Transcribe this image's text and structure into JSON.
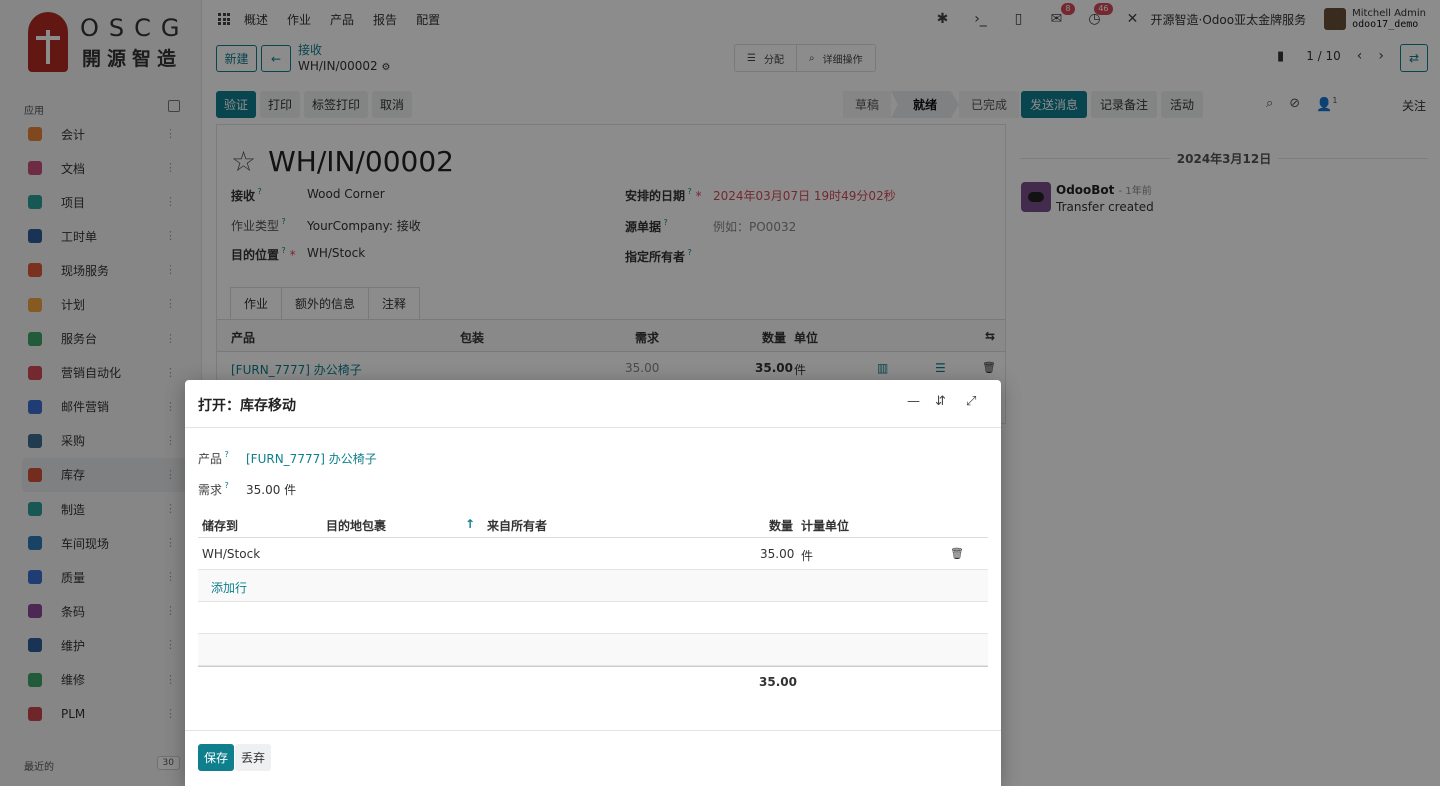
{
  "brand": {
    "line1": "OSCG",
    "line2": "開源智造"
  },
  "sidebar": {
    "section_label": "应用",
    "items": [
      {
        "label": "会计",
        "color": "#e8833a"
      },
      {
        "label": "文档",
        "color": "#c94f7c"
      },
      {
        "label": "项目",
        "color": "#2aa19a"
      },
      {
        "label": "工时单",
        "color": "#2f5d9c"
      },
      {
        "label": "现场服务",
        "color": "#e05a3a"
      },
      {
        "label": "计划",
        "color": "#f2a541"
      },
      {
        "label": "服务台",
        "color": "#3fa66b"
      },
      {
        "label": "营销自动化",
        "color": "#d44c59"
      },
      {
        "label": "邮件营销",
        "color": "#3a6fd1"
      },
      {
        "label": "采购",
        "color": "#3b6e8f"
      },
      {
        "label": "库存",
        "color": "#d4513a"
      },
      {
        "label": "制造",
        "color": "#2aa19a"
      },
      {
        "label": "车间现场",
        "color": "#2f7ab8"
      },
      {
        "label": "质量",
        "color": "#3a6fd1"
      },
      {
        "label": "条码",
        "color": "#8f4a9c"
      },
      {
        "label": "维护",
        "color": "#2f5d9c"
      },
      {
        "label": "维修",
        "color": "#3fa66b"
      },
      {
        "label": "PLM",
        "color": "#c9454f"
      }
    ],
    "active_index": 10,
    "footer_label": "最近的",
    "footer_count": "30"
  },
  "topbar": {
    "menu": [
      "概述",
      "作业",
      "产品",
      "报告",
      "配置"
    ],
    "messages_badge": "8",
    "activities_badge": "46",
    "company": "开源智造·Odoo亚太金牌服务",
    "user_name": "Mitchell Admin",
    "db_name": "odoo17_demo"
  },
  "control": {
    "new_label": "新建",
    "breadcrumb_parent": "接收",
    "breadcrumb_current": "WH/IN/00002",
    "assign_label": "分配",
    "details_label": "详细操作",
    "pager": "1 / 10"
  },
  "actions": {
    "validate": "验证",
    "print": "打印",
    "label_print": "标签打印",
    "cancel": "取消"
  },
  "status": {
    "draft": "草稿",
    "ready": "就绪",
    "done": "已完成"
  },
  "record": {
    "title": "WH/IN/00002",
    "receive_from_label": "接收",
    "receive_from": "Wood Corner",
    "op_type_label": "作业类型",
    "op_type": "YourCompany: 接收",
    "dest_label": "目的位置",
    "dest": "WH/Stock",
    "scheduled_label": "安排的日期",
    "scheduled": "2024年03月07日 19时49分02秒",
    "source_label": "源单据",
    "source_placeholder": "例如：PO0032",
    "owner_label": "指定所有者",
    "tabs": [
      "作业",
      "额外的信息",
      "注释"
    ],
    "columns": {
      "product": "产品",
      "package": "包装",
      "demand": "需求",
      "qty": "数量",
      "uom": "单位"
    },
    "line": {
      "product": "[FURN_7777] 办公椅子",
      "demand": "35.00",
      "qty": "35.00",
      "uom": "件"
    }
  },
  "chatter": {
    "send": "发送消息",
    "note": "记录备注",
    "activity": "活动",
    "followers": "1",
    "follow": "关注",
    "date": "2024年3月12日",
    "author": "OdooBot",
    "when": "- 1年前",
    "message": "Transfer created"
  },
  "dialog": {
    "title": "打开：库存移动",
    "product_label": "产品",
    "product": "[FURN_7777] 办公椅子",
    "demand_label": "需求",
    "demand": "35.00 件",
    "columns": {
      "store_to": "储存到",
      "dest_pkg": "目的地包裹",
      "from_owner": "来自所有者",
      "qty": "数量",
      "uom": "计量单位"
    },
    "row": {
      "store_to": "WH/Stock",
      "qty": "35.00",
      "uom": "件"
    },
    "add_line": "添加行",
    "total": "35.00",
    "save": "保存",
    "discard": "丢弃"
  }
}
